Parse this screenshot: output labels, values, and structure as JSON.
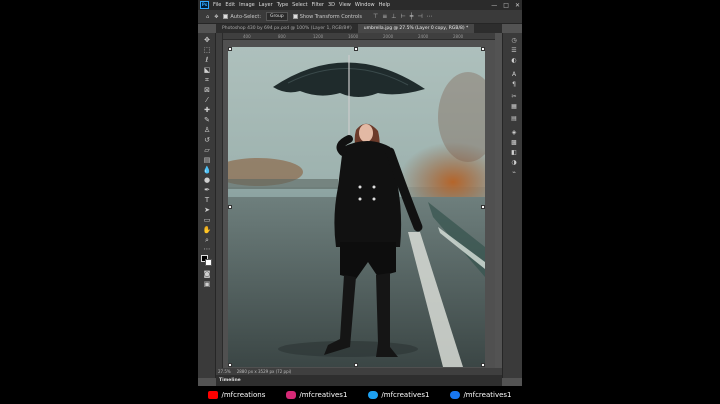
{
  "app": {
    "logo": "Ps",
    "menu": [
      "File",
      "Edit",
      "Image",
      "Layer",
      "Type",
      "Select",
      "Filter",
      "3D",
      "View",
      "Window",
      "Help"
    ],
    "window_controls": [
      "—",
      "□",
      "✕"
    ]
  },
  "options": {
    "auto_select_label": "Auto-Select:",
    "group_value": "Group",
    "transform_label": "Show Transform Controls"
  },
  "tabs": [
    {
      "label": "Photoshop 430 by 694 px.psd @ 100% (Layer 1, RGB/8#)",
      "active": false
    },
    {
      "label": "umbrella.jpg @ 27.5% (Layer 0 copy, RGB/8) *",
      "active": true
    }
  ],
  "ruler": {
    "ticks": [
      "400",
      "800",
      "1200",
      "1600",
      "2000",
      "2400",
      "2800"
    ]
  },
  "status": {
    "zoom": "27.5%",
    "doc_info": "2880 px x 3529 px (72 ppi)"
  },
  "timeline": {
    "label": "Timeline"
  },
  "social": [
    {
      "handle": "/mfcreations",
      "icon": "youtube-icon",
      "color": "#ff0000"
    },
    {
      "handle": "/mfcreatives1",
      "icon": "instagram-icon",
      "color": "#d62976"
    },
    {
      "handle": "/mfcreatives1",
      "icon": "twitter-icon",
      "color": "#1da1f2"
    },
    {
      "handle": "/mfcreatives1",
      "icon": "facebook-icon",
      "color": "#1877f2"
    }
  ],
  "colors": {
    "ps_blue": "#31a8ff",
    "panel": "#3a3a3a",
    "workspace": "#535353"
  }
}
